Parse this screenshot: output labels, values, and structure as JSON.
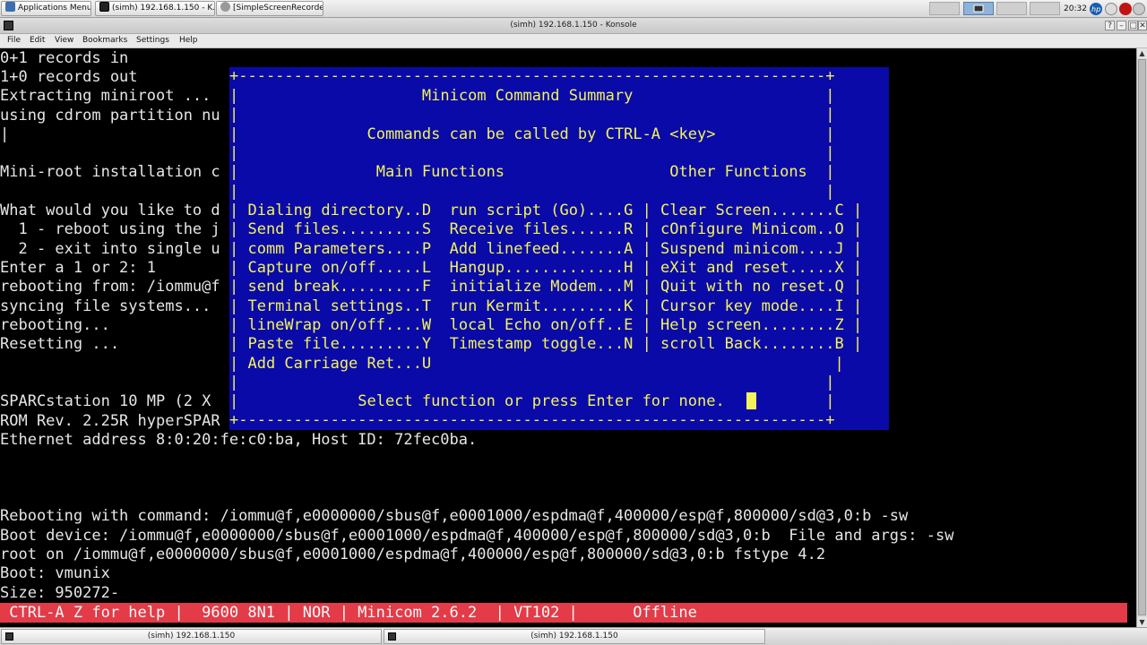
{
  "top_panel": {
    "apps_menu_label": "Applications Menu",
    "tasks": [
      {
        "label": "(simh) 192.168.1.150 - K...",
        "icon": "terminal-icon"
      },
      {
        "label": "[SimpleScreenRecorder]",
        "icon": "recorder-icon"
      }
    ],
    "workspaces": [
      "1",
      "2",
      "3",
      "4",
      "5"
    ],
    "active_workspace": 2,
    "clock": "20:32",
    "tray_icons": [
      "hp-icon",
      "network-icon",
      "record-icon",
      "power-icon"
    ]
  },
  "window": {
    "title": "(simh) 192.168.1.150 - Konsole",
    "controls": [
      "?",
      "–",
      "□",
      "✕"
    ]
  },
  "menu_bar": {
    "items": [
      "File",
      "Edit",
      "View",
      "Bookmarks",
      "Settings",
      "Help"
    ]
  },
  "terminal": {
    "lines": [
      "0+1 records in",
      "1+0 records out",
      "Extracting miniroot ... ",
      "using cdrom partition nu",
      "|",
      "",
      "Mini-root installation c",
      "",
      "What would you like to d",
      "  1 - reboot using the j",
      "  2 - exit into single u",
      "Enter a 1 or 2: 1",
      "rebooting from: /iommu@f",
      "syncing file systems... ",
      "rebooting...",
      "Resetting ...",
      "",
      "",
      "SPARCstation 10 MP (2 X ",
      "ROM Rev. 2.25R hyperSPAR",
      "Ethernet address 8:0:20:fe:c0:ba, Host ID: 72fec0ba.",
      "",
      "",
      "",
      "Rebooting with command: /iommu@f,e0000000/sbus@f,e0001000/espdma@f,400000/esp@f,800000/sd@3,0:b -sw",
      "Boot device: /iommu@f,e0000000/sbus@f,e0001000/espdma@f,400000/esp@f,800000/sd@3,0:b  File and args: -sw",
      "root on /iommu@f,e0000000/sbus@f,e0001000/espdma@f,400000/esp@f,800000/sd@3,0:b fstype 4.2",
      "Boot: vmunix",
      "Size: 950272-"
    ]
  },
  "minicom": {
    "lines": [
      "+----------------------------------------------------------------+",
      "|                    Minicom Command Summary                     |",
      "|                                                                |",
      "|              Commands can be called by CTRL-A <key>            |",
      "|                                                                |",
      "|               Main Functions                  Other Functions  |",
      "|                                                                |",
      "| Dialing directory..D  run script (Go)....G | Clear Screen.......C |",
      "| Send files.........S  Receive files......R | cOnfigure Minicom..O |",
      "| comm Parameters....P  Add linefeed.......A | Suspend minicom....J |",
      "| Capture on/off.....L  Hangup.............H | eXit and reset.....X |",
      "| send break.........F  initialize Modem...M | Quit with no reset.Q |",
      "| Terminal settings..T  run Kermit.........K | Cursor key mode....I |",
      "| lineWrap on/off....W  local Echo on/off..E | Help screen........Z |",
      "| Paste file.........Y  Timestamp toggle...N | scroll Back........B |",
      "| Add Carriage Ret...U                                            |",
      "|                                                                |",
      "|             Select function or press Enter for none.           |",
      "+----------------------------------------------------------------+"
    ]
  },
  "status_bar": {
    "text": " CTRL-A Z for help |  9600 8N1 | NOR | Minicom 2.6.2  | VT102 |      Offline"
  },
  "taskbar": {
    "items": [
      {
        "label": "(simh) 192.168.1.150",
        "icon": "terminal-icon"
      },
      {
        "label": "(simh) 192.168.1.150",
        "icon": "terminal-icon"
      }
    ]
  },
  "colors": {
    "terminal_bg": "#000000",
    "terminal_fg": "#e6e6e6",
    "dialog_bg": "#0a0aa8",
    "dialog_fg": "#f3f35c",
    "status_bg": "#e33b48",
    "status_fg": "#fafafa"
  }
}
